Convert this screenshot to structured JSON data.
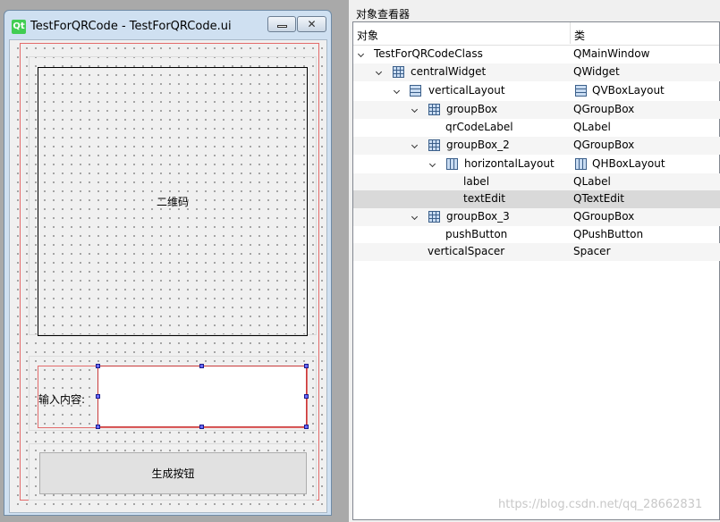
{
  "form_window": {
    "title": "TestForQRCode - TestForQRCode.ui",
    "logo_text": "Qt",
    "close_glyph": "✕",
    "qr_label_text": "二维码",
    "input_label_text": "输入内容:",
    "push_button_text": "生成按钮"
  },
  "inspector": {
    "title": "对象查看器",
    "col_object": "对象",
    "col_class": "类",
    "rows": [
      {
        "name": "TestForQRCodeClass",
        "class": "QMainWindow",
        "icon": "none",
        "class_icon": "none",
        "expanded": true
      },
      {
        "name": "centralWidget",
        "class": "QWidget",
        "icon": "grid-layout-icon",
        "class_icon": "none",
        "expanded": true
      },
      {
        "name": "verticalLayout",
        "class": "QVBoxLayout",
        "icon": "vbox-layout-icon",
        "class_icon": "vbox-layout-icon",
        "expanded": true
      },
      {
        "name": "groupBox",
        "class": "QGroupBox",
        "icon": "grid-layout-icon",
        "class_icon": "none",
        "expanded": true
      },
      {
        "name": "qrCodeLabel",
        "class": "QLabel",
        "icon": "none",
        "class_icon": "none",
        "expanded": false
      },
      {
        "name": "groupBox_2",
        "class": "QGroupBox",
        "icon": "grid-layout-icon",
        "class_icon": "none",
        "expanded": true
      },
      {
        "name": "horizontalLayout",
        "class": "QHBoxLayout",
        "icon": "hbox-layout-icon",
        "class_icon": "hbox-layout-icon",
        "expanded": true
      },
      {
        "name": "label",
        "class": "QLabel",
        "icon": "none",
        "class_icon": "none",
        "expanded": false
      },
      {
        "name": "textEdit",
        "class": "QTextEdit",
        "icon": "none",
        "class_icon": "none",
        "expanded": false,
        "selected": true
      },
      {
        "name": "groupBox_3",
        "class": "QGroupBox",
        "icon": "grid-layout-icon",
        "class_icon": "none",
        "expanded": true
      },
      {
        "name": "pushButton",
        "class": "QPushButton",
        "icon": "none",
        "class_icon": "none",
        "expanded": false
      },
      {
        "name": "verticalSpacer",
        "class": "Spacer",
        "icon": "none",
        "class_icon": "none",
        "expanded": false
      }
    ]
  },
  "watermark": "https://blog.csdn.net/qq_28662831",
  "colors": {
    "layout_border": "#e36b6b",
    "selection_handle": "#6a6aff",
    "selected_row": "#d9d9d9",
    "qt_green": "#41cd52"
  }
}
